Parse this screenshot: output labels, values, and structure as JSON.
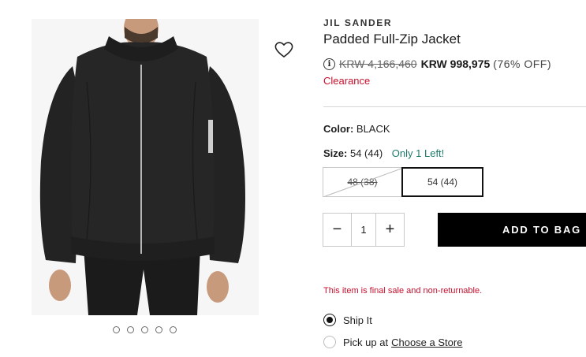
{
  "product": {
    "brand": "JIL SANDER",
    "title": "Padded Full-Zip Jacket",
    "original_price": "KRW 4,166,460",
    "sale_price": "KRW 998,975",
    "discount": "(76% OFF)",
    "clearance_label": "Clearance"
  },
  "options": {
    "color_label": "Color:",
    "color_value": "BLACK",
    "size_label": "Size:",
    "size_value": "54 (44)",
    "stock_note": "Only 1 Left!",
    "sizes": [
      {
        "label": "48 (38)",
        "available": false
      },
      {
        "label": "54 (44)",
        "available": true,
        "selected": true
      }
    ]
  },
  "purchase": {
    "quantity": "1",
    "minus_symbol": "−",
    "plus_symbol": "+",
    "add_to_bag_label": "ADD TO BAG",
    "final_sale_note": "This item is final sale and non-returnable."
  },
  "fulfillment": {
    "ship_label": "Ship It",
    "pickup_label": "Pick up at",
    "pickup_link": "Choose a Store"
  },
  "gallery": {
    "image_count": 5,
    "active_index": 0,
    "icons": [
      "heart-icon",
      "info-icon"
    ]
  },
  "colors": {
    "accent_red": "#c8102e",
    "stock_green": "#1e7b6a",
    "button_black": "#000000"
  }
}
